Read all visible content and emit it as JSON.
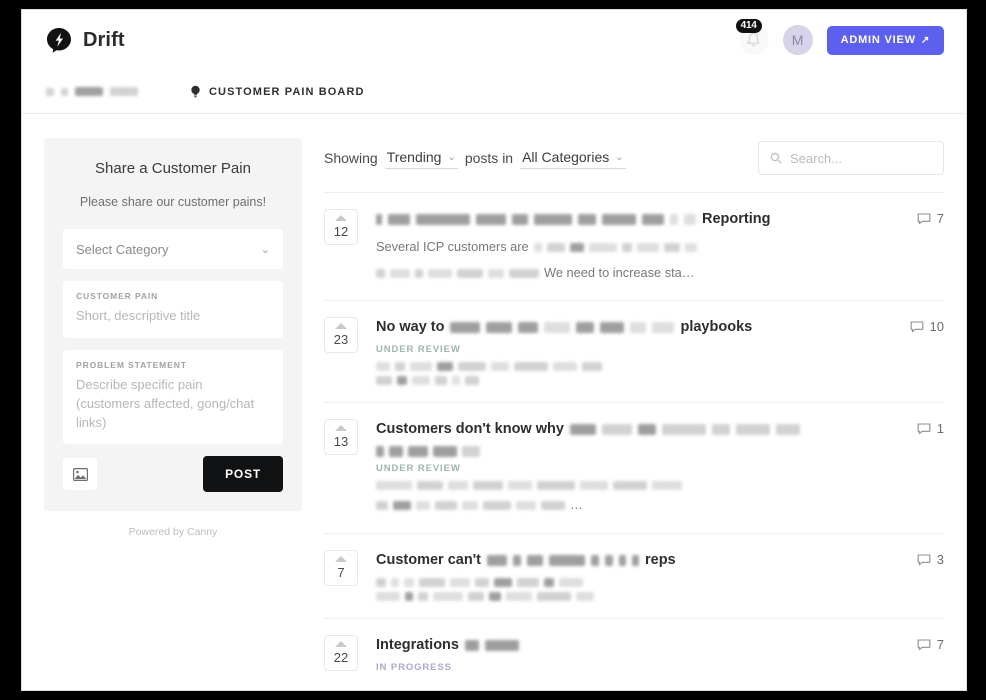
{
  "topbar": {
    "brand": "Drift",
    "logo_icon": "drift-speech-bubble-icon",
    "notification_icon": "bell-icon",
    "notification_badge": "414",
    "avatar_initial": "M",
    "admin_button_label": "ADMIN VIEW",
    "admin_button_arrow": "↗",
    "admin_button_color": "#5d5fef"
  },
  "breadcrumb": {
    "board_icon": "lightbulb-icon",
    "board_label": "CUSTOMER PAIN BOARD"
  },
  "sidebar": {
    "title": "Share a Customer Pain",
    "subtitle": "Please share our customer pains!",
    "category_select": {
      "value": "Select Category",
      "chevron": "⌄"
    },
    "fields": [
      {
        "label": "CUSTOMER PAIN",
        "placeholder": "Short, descriptive title"
      },
      {
        "label": "PROBLEM STATEMENT",
        "placeholder": "Describe specific pain (customers affected, gong/chat links)"
      }
    ],
    "image_button_icon": "image-upload-icon",
    "post_button_label": "POST",
    "powered_by": "Powered by Canny"
  },
  "filterbar": {
    "showing_label": "Showing",
    "sort_value": "Trending",
    "posts_in_label": "posts in",
    "category_value": "All Categories",
    "chevron": "⌄",
    "search_icon": "search-icon",
    "search_placeholder": "Search..."
  },
  "posts": [
    {
      "votes": "12",
      "title_suffix": "Reporting",
      "status": null,
      "comments": "7",
      "comment_icon": "comment-bubble-icon",
      "body_start": "Several ICP customers are",
      "body_end": "We need to increase sta…"
    },
    {
      "votes": "23",
      "title_prefix": "No way to",
      "title_suffix": "playbooks",
      "status": "UNDER REVIEW",
      "status_kind": "review",
      "comments": "10",
      "comment_icon": "comment-bubble-icon",
      "body_start": "",
      "body_end": ""
    },
    {
      "votes": "13",
      "title_prefix": "Customers don't know why",
      "title_suffix": "",
      "status": "UNDER REVIEW",
      "status_kind": "review",
      "comments": "1",
      "comment_icon": "comment-bubble-icon",
      "body_start": "",
      "body_end": "…"
    },
    {
      "votes": "7",
      "title_prefix": "Customer can't",
      "title_suffix": "reps",
      "status": null,
      "comments": "3",
      "comment_icon": "comment-bubble-icon",
      "body_start": "",
      "body_end": ""
    },
    {
      "votes": "22",
      "title_prefix": "Integrations",
      "title_suffix": "",
      "status": "IN PROGRESS",
      "status_kind": "progress",
      "comments": "7",
      "comment_icon": "comment-bubble-icon",
      "body_start": "",
      "body_end": ""
    }
  ]
}
